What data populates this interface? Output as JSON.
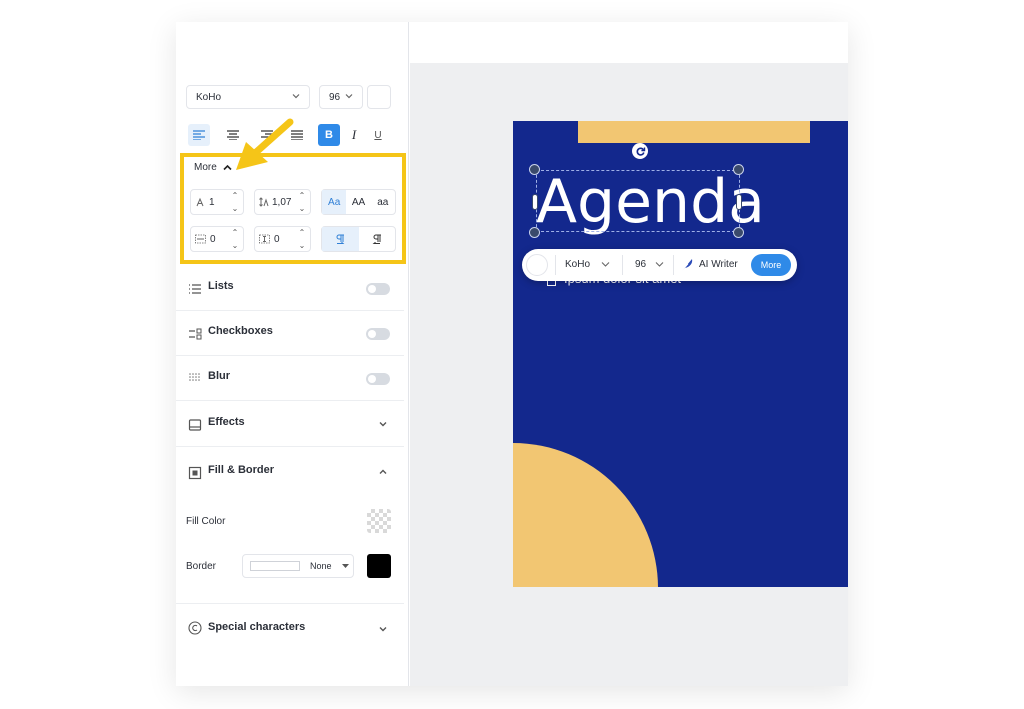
{
  "sidebar": {
    "font": "KoHo",
    "size": "96",
    "format": {
      "bold": "B",
      "italic": "I",
      "underline": "U"
    },
    "more_label": "More",
    "letter_spacing": "1",
    "line_height": "1,07",
    "case_options": [
      "Aa",
      "AA",
      "aa"
    ],
    "indent_left": "0",
    "indent_right": "0",
    "sections": [
      {
        "label": "Lists",
        "control": "toggle"
      },
      {
        "label": "Checkboxes",
        "control": "toggle"
      },
      {
        "label": "Blur",
        "control": "toggle"
      },
      {
        "label": "Effects",
        "control": "chevron-down"
      },
      {
        "label": "Fill & Border",
        "control": "chevron-up"
      }
    ],
    "fill_color_label": "Fill Color",
    "border_label": "Border",
    "border_style": "None",
    "border_color": "#000000",
    "special_chars_label": "Special characters"
  },
  "canvas": {
    "heading": "Agenda",
    "bullet_text": "Ipsum dolor sit amet",
    "colors": {
      "background": "#13288d",
      "accent": "#f2c672"
    }
  },
  "float_toolbar": {
    "font": "KoHo",
    "size": "96",
    "ai_writer": "AI Writer",
    "more": "More"
  },
  "accent_color": "#2f8ae8",
  "highlight_color": "#f5c518"
}
